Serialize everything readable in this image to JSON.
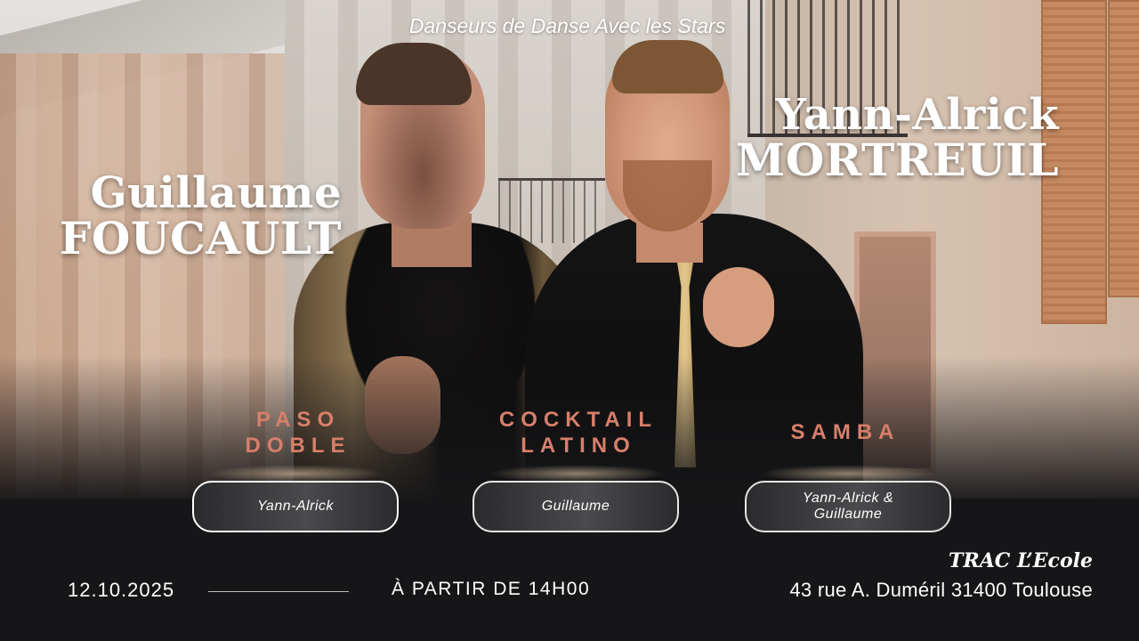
{
  "header": {
    "subtitle": "Danseurs de Danse Avec les Stars"
  },
  "dancers": [
    {
      "first_name": "Guillaume",
      "last_name": "FOUCAULT"
    },
    {
      "first_name": "Yann-Alrick",
      "last_name": "MORTREUIL"
    }
  ],
  "dances": [
    {
      "style_line1": "PASO",
      "style_line2": "DOBLE",
      "performer": "Yann-Alrick"
    },
    {
      "style_line1": "COCKTAIL",
      "style_line2": "LATINO",
      "performer": "Guillaume"
    },
    {
      "style_line1": "SAMBA",
      "style_line2": "",
      "performer_line1": "Yann-Alrick &",
      "performer_line2": "Guillaume"
    }
  ],
  "event": {
    "date": "12.10.2025",
    "time": "À PARTIR DE 14H00",
    "venue": "TRAC L’Ecole",
    "address": "43 rue A. Duméril 31400 Toulouse"
  },
  "colors": {
    "accent": "#d77f6b",
    "background": "#161618",
    "text": "#ffffff"
  }
}
